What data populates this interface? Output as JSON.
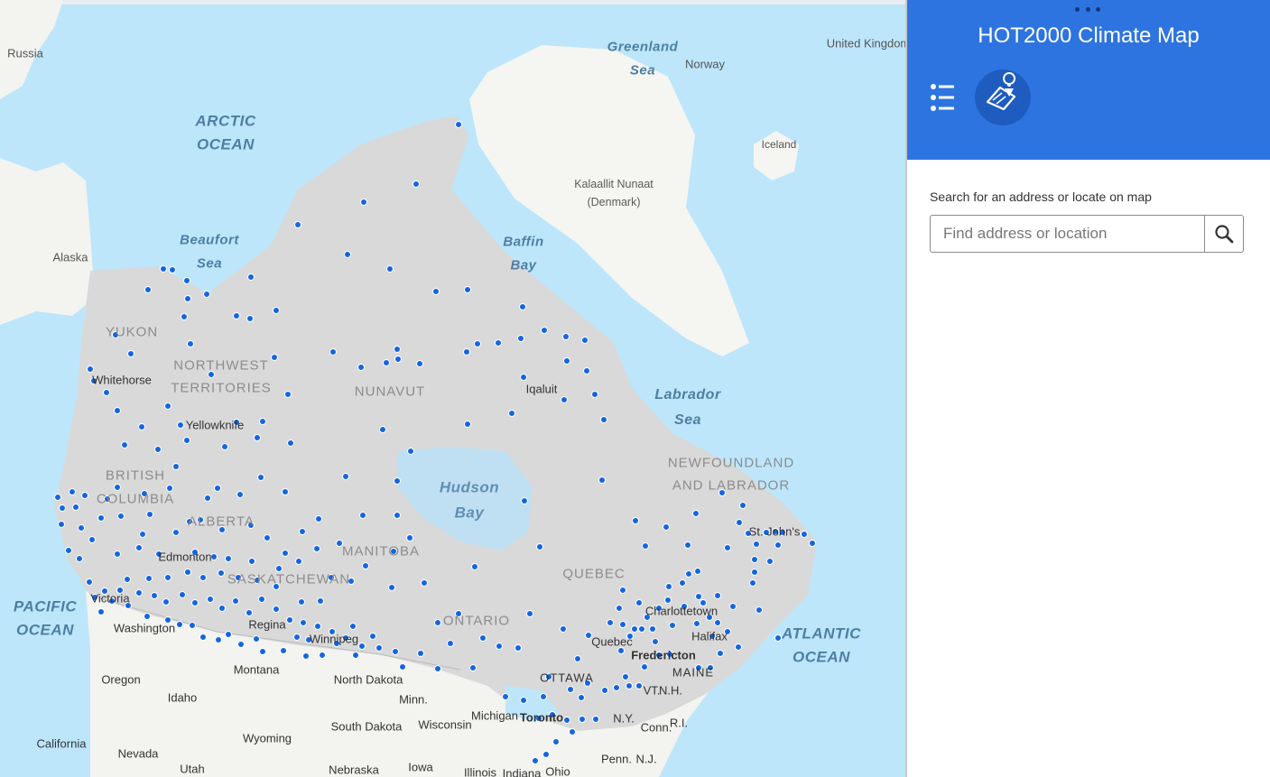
{
  "panel": {
    "title": "HOT2000 Climate Map",
    "search_label": "Search for an address or locate on map",
    "search_placeholder": "Find address or location",
    "list_icon": "list-icon",
    "locate_icon": "map-pin-icon",
    "search_icon": "search-icon",
    "header_color": "#2d74e0"
  },
  "map": {
    "station_color": "#1565e0",
    "oceans": [
      "ARCTIC",
      "OCEAN",
      "PACIFIC",
      "OCEAN",
      "ATLANTIC",
      "OCEAN",
      "Beaufort",
      "Sea",
      "Baffin",
      "Bay",
      "Hudson",
      "Bay",
      "Labrador",
      "Sea",
      "Greenland",
      "Sea"
    ],
    "provinces": [
      "YUKON",
      "NORTHWEST",
      "TERRITORIES",
      "NUNAVUT",
      "BRITISH",
      "COLUMBIA",
      "ALBERTA",
      "SASKATCHEWAN",
      "MANITOBA",
      "ONTARIO",
      "QUEBEC",
      "NEWFOUNDLAND",
      "AND LABRADOR"
    ],
    "countries": [
      "Russia",
      "Alaska",
      "United Kingdom",
      "Norway",
      "Iceland",
      "Kalaallit Nunaat",
      "(Denmark)"
    ],
    "cities": [
      "Whitehorse",
      "Yellowknife",
      "Iqaluit",
      "Edmonton",
      "Victoria",
      "Washington",
      "Regina",
      "Winnipeg",
      "OTTAWA",
      "Toronto",
      "Quebec",
      "Fredericton",
      "Charlottetown",
      "Halifax",
      "St. John's",
      "Oregon",
      "Idaho",
      "Montana",
      "North Dakota",
      "Minn.",
      "South Dakota",
      "Wisconsin",
      "Michigan",
      "Wyoming",
      "Nevada",
      "California",
      "Utah",
      "Nebraska",
      "Iowa",
      "Illinois",
      "Indiana",
      "Ohio",
      "Penn.",
      "N.J.",
      "N.Y.",
      "Conn.",
      "R.I.",
      "VT.",
      "N.H.",
      "MAINE"
    ]
  }
}
